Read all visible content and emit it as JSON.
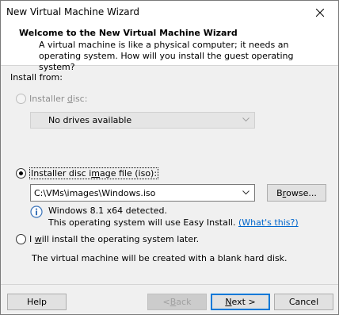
{
  "window": {
    "title": "New Virtual Machine Wizard",
    "close_glyph": "✕"
  },
  "header": {
    "title": "Welcome to the New Virtual Machine Wizard",
    "description": "A virtual machine is like a physical computer; it needs an operating system. How will you install the guest operating system?"
  },
  "install_from": {
    "label": "Install from:",
    "installer_disc": {
      "label_pre": "Installer ",
      "label_key": "d",
      "label_post": "isc:",
      "selected": false,
      "enabled": false,
      "drive_value": "No drives available"
    },
    "iso": {
      "label_pre": "Installer disc i",
      "label_key": "m",
      "label_post": "age file (iso):",
      "selected": true,
      "path_value": "C:\\VMs\\images\\Windows.iso",
      "browse_pre": "B",
      "browse_key": "r",
      "browse_post": "owse...",
      "detected_text": "Windows 8.1 x64 detected.",
      "easy_install_text": "This operating system will use Easy Install. ",
      "whats_this_link": "(What's this?)"
    },
    "later": {
      "label_pre": "I ",
      "label_key": "w",
      "label_post": "ill install the operating system later.",
      "selected": false,
      "note": "The virtual machine will be created with a blank hard disk."
    }
  },
  "footer": {
    "help_label": "Help",
    "back_pre": "< ",
    "back_key": "B",
    "back_post": "ack",
    "next_key": "N",
    "next_post": "ext >",
    "cancel_label": "Cancel"
  },
  "icons": {
    "close": "close-icon",
    "dropdown": "chevron-down-icon",
    "info": "info-icon"
  },
  "colors": {
    "link": "#0066cc",
    "default_button_border": "#0078d7",
    "disabled_text": "#8d8d8d"
  }
}
